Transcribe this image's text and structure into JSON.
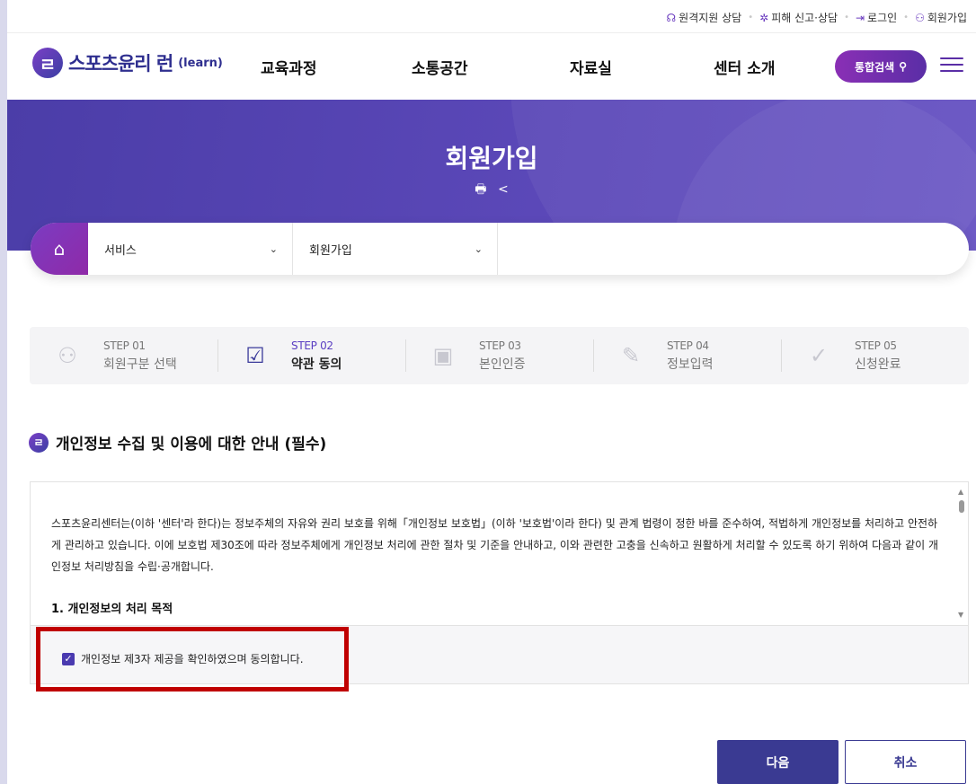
{
  "util": {
    "remote_support": "원격지원 상담",
    "report": "피해 신고·상담",
    "login": "로그인",
    "signup": "회원가입"
  },
  "logo": {
    "mark": "ㄹ",
    "name": "스포츠윤리 런",
    "sub": "(learn)"
  },
  "nav": {
    "items": [
      "교육과정",
      "소통공간",
      "자료실",
      "센터 소개"
    ],
    "search_label": "통합검색"
  },
  "banner": {
    "title": "회원가입"
  },
  "breadcrumb": {
    "level1": "서비스",
    "level2": "회원가입"
  },
  "steps": [
    {
      "num": "STEP 01",
      "label": "회원구분 선택",
      "active": false
    },
    {
      "num": "STEP 02",
      "label": "약관 동의",
      "active": true
    },
    {
      "num": "STEP 03",
      "label": "본인인증",
      "active": false
    },
    {
      "num": "STEP 04",
      "label": "정보입력",
      "active": false
    },
    {
      "num": "STEP 05",
      "label": "신청완료",
      "active": false
    }
  ],
  "section": {
    "title": "개인정보 수집 및 이용에 대한 안내 (필수)"
  },
  "terms": {
    "body": "스포츠윤리센터는(이하 '센터'라 한다)는 정보주체의 자유와 권리 보호를 위해「개인정보 보호법」(이하 '보호법'이라 한다) 및 관계 법령이 정한 바를 준수하여, 적법하게 개인정보를 처리하고 안전하게 관리하고 있습니다. 이에 보호법 제30조에 따라 정보주체에게 개인정보 처리에 관한 절차 및 기준을 안내하고, 이와 관련한 고충을 신속하고 원활하게 처리할 수 있도록 하기 위하여 다음과 같이 개인정보 처리방침을 수립·공개합니다.",
    "heading": "1. 개인정보의 처리 목적"
  },
  "agree": {
    "label": "개인정보 제3자 제공을 확인하였으며 동의합니다.",
    "checked": true
  },
  "buttons": {
    "next": "다음",
    "cancel": "취소"
  },
  "colors": {
    "brand": "#3a3a92",
    "banner": "#5b48b8",
    "accent": "#7b3cc2",
    "highlight": "#c00000"
  }
}
